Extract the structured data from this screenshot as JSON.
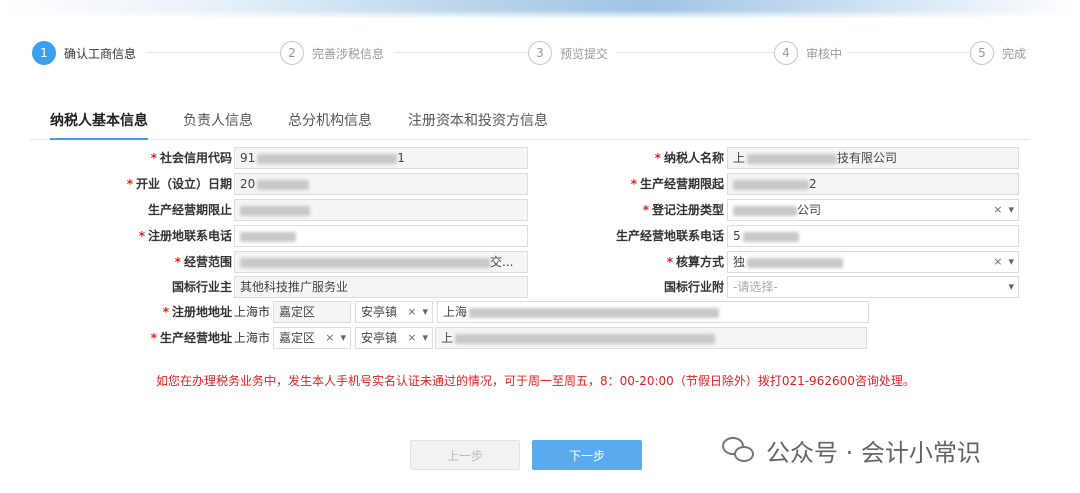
{
  "steps": [
    {
      "num": "1",
      "label": "确认工商信息",
      "active": true
    },
    {
      "num": "2",
      "label": "完善涉税信息"
    },
    {
      "num": "3",
      "label": "预览提交"
    },
    {
      "num": "4",
      "label": "审核中"
    },
    {
      "num": "5",
      "label": "完成"
    }
  ],
  "tabs": [
    "纳税人基本信息",
    "负责人信息",
    "总分机构信息",
    "注册资本和投资方信息"
  ],
  "required_mark": "*",
  "form": {
    "credit_code": {
      "label": "社会信用代码",
      "value_prefix": "91",
      "value_suffix": "1"
    },
    "taxpayer_name": {
      "label": "纳税人名称",
      "value_prefix": "上",
      "value_suffix": "技有限公司"
    },
    "open_date": {
      "label": "开业（设立）日期",
      "value_prefix": "20"
    },
    "period_start": {
      "label": "生产经营期限起",
      "value_suffix": "2"
    },
    "period_end": {
      "label": "生产经营期限止"
    },
    "reg_type": {
      "label": "登记注册类型",
      "value_suffix": "公司"
    },
    "reg_phone": {
      "label": "注册地联系电话"
    },
    "biz_phone": {
      "label": "生产经营地联系电话",
      "value_prefix": "5"
    },
    "scope": {
      "label": "经营范围",
      "value_suffix": "交..."
    },
    "accounting": {
      "label": "核算方式",
      "value_prefix": "独"
    },
    "industry_main": {
      "label": "国标行业主",
      "value": "其他科技推广服务业"
    },
    "industry_sub": {
      "label": "国标行业附",
      "placeholder": "-请选择-"
    },
    "reg_address": {
      "label": "注册地地址",
      "city": "上海市",
      "district": "嘉定区",
      "town": "安亭镇",
      "detail_prefix": "上海"
    },
    "biz_address": {
      "label": "生产经营地址",
      "city": "上海市",
      "district": "嘉定区",
      "town": "安亭镇",
      "detail_prefix": "上"
    }
  },
  "clear_glyph": "×",
  "dropdown_glyph": "▾",
  "notice": "如您在办理税务业务中，发生本人手机号实名认证未通过的情况，可于周一至周五，8：00-20:00（节假日除外）拨打021-962600咨询处理。",
  "buttons": {
    "prev": "上一步",
    "next": "下一步"
  },
  "watermark": "公众号 · 会计小常识",
  "colors": {
    "accent": "#3a9ff0",
    "required": "#e02020",
    "notice": "#e02020"
  }
}
